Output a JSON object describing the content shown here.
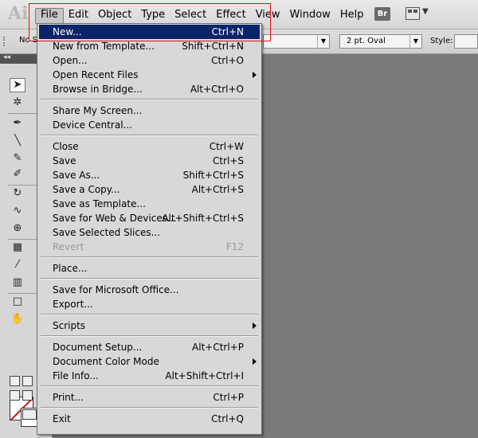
{
  "app": {
    "logo": "Ai",
    "bridge_label": "Br"
  },
  "menubar": {
    "items": [
      "File",
      "Edit",
      "Object",
      "Type",
      "Select",
      "Effect",
      "View",
      "Window",
      "Help"
    ],
    "active": "File"
  },
  "controlbar": {
    "left_label": "No S",
    "brush_value": "2 pt. Oval",
    "style_label": "Style:"
  },
  "file_menu": {
    "items": [
      {
        "label": "New...",
        "shortcut": "Ctrl+N",
        "highlighted": true
      },
      {
        "label": "New from Template...",
        "shortcut": "Shift+Ctrl+N"
      },
      {
        "label": "Open...",
        "shortcut": "Ctrl+O"
      },
      {
        "label": "Open Recent Files",
        "shortcut": "",
        "submenu": true
      },
      {
        "label": "Browse in Bridge...",
        "shortcut": "Alt+Ctrl+O"
      },
      {
        "label": "Share My Screen...",
        "shortcut": ""
      },
      {
        "label": "Device Central...",
        "shortcut": ""
      },
      {
        "label": "Close",
        "shortcut": "Ctrl+W"
      },
      {
        "label": "Save",
        "shortcut": "Ctrl+S"
      },
      {
        "label": "Save As...",
        "shortcut": "Shift+Ctrl+S"
      },
      {
        "label": "Save a Copy...",
        "shortcut": "Alt+Ctrl+S"
      },
      {
        "label": "Save as Template...",
        "shortcut": ""
      },
      {
        "label": "Save for Web & Devices...",
        "shortcut": "Alt+Shift+Ctrl+S"
      },
      {
        "label": "Save Selected Slices...",
        "shortcut": ""
      },
      {
        "label": "Revert",
        "shortcut": "F12",
        "disabled": true
      },
      {
        "label": "Place...",
        "shortcut": ""
      },
      {
        "label": "Save for Microsoft Office...",
        "shortcut": ""
      },
      {
        "label": "Export...",
        "shortcut": ""
      },
      {
        "label": "Scripts",
        "shortcut": "",
        "submenu": true
      },
      {
        "label": "Document Setup...",
        "shortcut": "Alt+Ctrl+P"
      },
      {
        "label": "Document Color Mode",
        "shortcut": "",
        "submenu": true
      },
      {
        "label": "File Info...",
        "shortcut": "Alt+Shift+Ctrl+I"
      },
      {
        "label": "Print...",
        "shortcut": "Ctrl+P"
      },
      {
        "label": "Exit",
        "shortcut": "Ctrl+Q"
      }
    ]
  },
  "colors": {
    "highlight": "#0a246a",
    "annotation_box": "#e0101a",
    "canvas": "#7a7a7a"
  }
}
